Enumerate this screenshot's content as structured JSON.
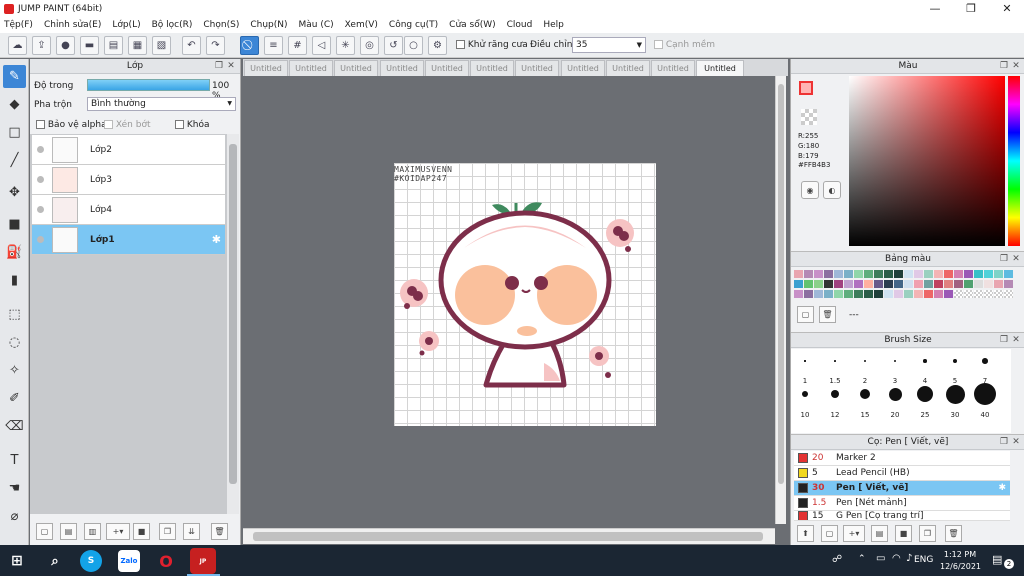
{
  "app": {
    "title": "JUMP PAINT (64bit)"
  },
  "menu": [
    "Tệp(F)",
    "Chỉnh sửa(E)",
    "Lớp(L)",
    "Bộ lọc(R)",
    "Chọn(S)",
    "Chụp(N)",
    "Màu (C)",
    "Xem(V)",
    "Công cụ(T)",
    "Cửa sổ(W)",
    "Cloud",
    "Help"
  ],
  "toolbar": {
    "antialias_label": "Khử răng cưa",
    "adjust_label": "Điều chỉnh",
    "adjust_value": "35",
    "edge_label": "Cạnh mềm"
  },
  "layer_panel": {
    "title": "Lớp",
    "opacity_label": "Độ trong",
    "opacity_value": "100 %",
    "opacity": 1.0,
    "blend_label": "Pha trộn",
    "blend_value": "Bình thường",
    "protect_alpha": "Bảo vệ alpha",
    "clip": "Xén bớt",
    "lock": "Khóa",
    "layers": [
      {
        "name": "Lớp2"
      },
      {
        "name": "Lớp3"
      },
      {
        "name": "Lớp4"
      },
      {
        "name": "Lớp1"
      }
    ]
  },
  "tabs": [
    "Untitled",
    "Untitled",
    "Untitled",
    "Untitled",
    "Untitled",
    "Untitled",
    "Untitled",
    "Untitled",
    "Untitled",
    "Untitled",
    "Untitled"
  ],
  "canvas": {
    "watermark_line1": "MAXIMUSVENN",
    "watermark_line2": "#KOIDAP247"
  },
  "color_panel": {
    "title": "Màu",
    "r": "R:255",
    "g": "G:180",
    "b": "B:179",
    "hex": "#FFB4B3",
    "current": "#FFB4B3"
  },
  "palette": {
    "title": "Bảng màu",
    "extra": "---"
  },
  "brush_size": {
    "title": "Brush Size",
    "sizes": [
      "1",
      "1.5",
      "2",
      "3",
      "4",
      "5",
      "7",
      "10",
      "12",
      "15",
      "20",
      "25",
      "30",
      "40"
    ]
  },
  "brush_list": {
    "title": "Cọ: Pen [ Viết, vẽ]",
    "items": [
      {
        "size": "20",
        "name": "Marker 2",
        "color": "#e33333"
      },
      {
        "size": "5",
        "name": "Lead Pencil (HB)",
        "color": "#f2d81e"
      },
      {
        "size": "30",
        "name": "Pen [ Viết, vẽ]",
        "color": "#222222"
      },
      {
        "size": "1.5",
        "name": "Pen [Nét mảnh]",
        "color": "#222222"
      },
      {
        "size": "15",
        "name": "G Pen [Cọ trang trí]",
        "color": "#e33333"
      }
    ]
  },
  "taskbar": {
    "time": "1:12 PM",
    "date": "12/6/2021",
    "lang": "ENG",
    "notif": "2"
  }
}
